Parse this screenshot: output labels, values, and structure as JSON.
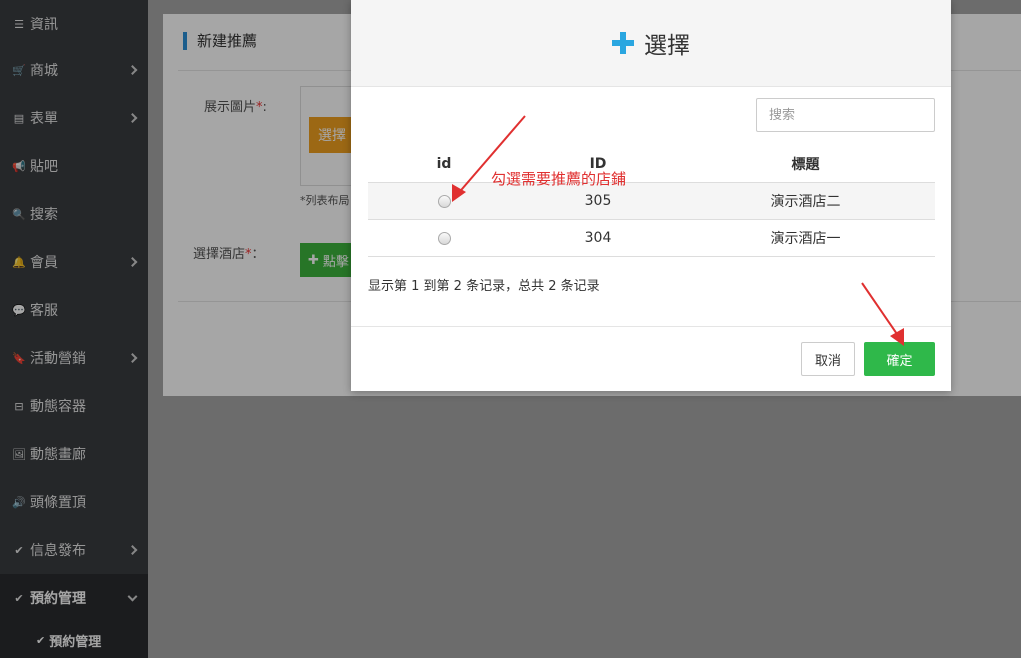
{
  "sidebar": {
    "items": [
      {
        "label": "資訊",
        "icon": "list-icon",
        "glyph": "☰",
        "has_children": false
      },
      {
        "label": "商城",
        "icon": "cart-icon",
        "glyph": "🛒",
        "has_children": true
      },
      {
        "label": "表單",
        "icon": "form-icon",
        "glyph": "▤",
        "has_children": true
      },
      {
        "label": "貼吧",
        "icon": "bullhorn-icon",
        "glyph": "📢",
        "has_children": false
      },
      {
        "label": "搜索",
        "icon": "search-icon",
        "glyph": "🔍",
        "has_children": false
      },
      {
        "label": "會員",
        "icon": "bell-icon",
        "glyph": "🔔",
        "has_children": true
      },
      {
        "label": "客服",
        "icon": "comment-icon",
        "glyph": "💬",
        "has_children": false
      },
      {
        "label": "活動營銷",
        "icon": "bookmark-icon",
        "glyph": "🔖",
        "has_children": true
      },
      {
        "label": "動態容器",
        "icon": "inbox-icon",
        "glyph": "⊟",
        "has_children": false
      },
      {
        "label": "動態畫廊",
        "icon": "picture-icon",
        "glyph": "🖼",
        "has_children": false
      },
      {
        "label": "頭條置頂",
        "icon": "volume-icon",
        "glyph": "🔊",
        "has_children": false
      },
      {
        "label": "信息發布",
        "icon": "check-edit-icon",
        "glyph": "✔",
        "has_children": true
      },
      {
        "label": "預約管理",
        "icon": "check-edit-icon",
        "glyph": "✔",
        "has_children": true
      }
    ],
    "sub_item": {
      "label": "預約管理",
      "icon": "check-edit-icon",
      "glyph": "✔"
    }
  },
  "background_form": {
    "title": "新建推薦",
    "image_label": "展示圖片",
    "image_label_suffix": ":",
    "select_button": "選擇",
    "hint": "*列表布局",
    "hotel_label": "選擇酒店",
    "hotel_label_suffix": "：",
    "add_button": "點擊",
    "required_mark": "*"
  },
  "modal": {
    "title": "選擇",
    "search_placeholder": "搜索",
    "table": {
      "headers": [
        "id",
        "ID",
        "標題"
      ],
      "rows": [
        {
          "selected": false,
          "id": "305",
          "title": "演示酒店二"
        },
        {
          "selected": false,
          "id": "304",
          "title": "演示酒店一"
        }
      ]
    },
    "pager_text": "显示第 1 到第 2 条记录，总共 2 条记录",
    "cancel_label": "取消",
    "confirm_label": "確定"
  },
  "annotation": {
    "text": "勾選需要推薦的店鋪",
    "color": "#e03030"
  },
  "colors": {
    "sidebar_bg": "#3a3d40",
    "accent_blue": "#2aa6e0",
    "confirm_green": "#2fb84a",
    "select_orange": "#f0a020"
  }
}
